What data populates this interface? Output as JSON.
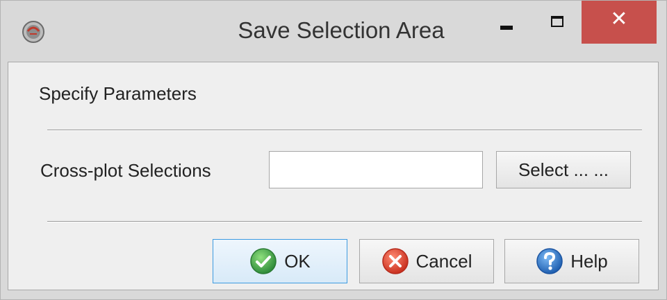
{
  "window": {
    "title": "Save Selection Area",
    "close_glyph": "✕"
  },
  "content": {
    "section_label": "Specify Parameters",
    "field_label": "Cross-plot Selections",
    "field_value": "",
    "select_button": "Select ... ..."
  },
  "footer": {
    "ok_label": "OK",
    "cancel_label": "Cancel",
    "help_label": "Help"
  },
  "icons": {
    "app": "app-logo-icon",
    "ok": "checkmark-icon",
    "cancel": "x-circle-icon",
    "help": "question-icon"
  },
  "colors": {
    "close_button": "#c7504c",
    "ok_green": "#3aa24a",
    "cancel_red": "#e04a37",
    "help_blue": "#2f7bd3",
    "focus_border": "#3c9ae0"
  }
}
